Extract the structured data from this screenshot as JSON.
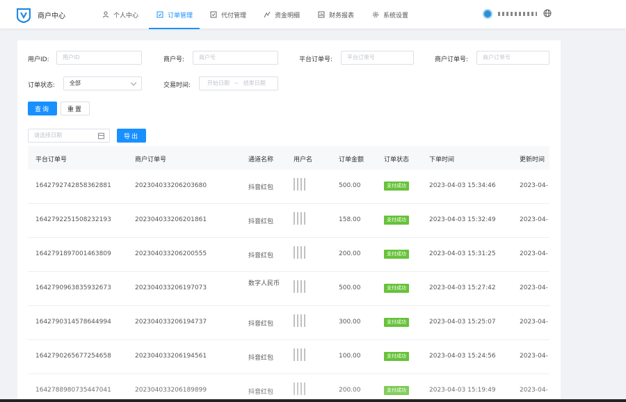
{
  "app": {
    "brand": "商户中心",
    "username": ""
  },
  "nav": [
    {
      "label": "个人中心",
      "icon": "user-icon"
    },
    {
      "label": "订单管理",
      "icon": "order-icon",
      "active": true
    },
    {
      "label": "代付管理",
      "icon": "payout-icon"
    },
    {
      "label": "资金明细",
      "icon": "funds-icon"
    },
    {
      "label": "财务报表",
      "icon": "report-icon"
    },
    {
      "label": "系统设置",
      "icon": "gear-icon"
    }
  ],
  "filters": {
    "user_id": {
      "label": "用户ID:",
      "placeholder": "用户ID"
    },
    "merchant_no": {
      "label": "商户号:",
      "placeholder": "商户号"
    },
    "platform_order": {
      "label": "平台订单号:",
      "placeholder": "平台订单号"
    },
    "merchant_order": {
      "label": "商户订单号:",
      "placeholder": "商户订单号"
    },
    "order_status": {
      "label": "订单状态:",
      "value": "全部"
    },
    "trade_time": {
      "label": "交易时间:",
      "start": "开始日期",
      "sep": "~",
      "end": "结束日期"
    }
  },
  "buttons": {
    "search": "查询",
    "reset": "重置",
    "export": "导出"
  },
  "export_date": {
    "placeholder": "请选择日期"
  },
  "table": {
    "headers": [
      "平台订单号",
      "商户订单号",
      "通道名称",
      "用户名",
      "订单金额",
      "订单状态",
      "下单时间",
      "更新时间"
    ],
    "rows": [
      {
        "platform": "1642792742858362881",
        "merchant": "202304033206203680",
        "channel": "抖音红包",
        "amount": "500.00",
        "status": "支付成功",
        "created": "2023-04-03 15:34:46",
        "updated": "2023-04-"
      },
      {
        "platform": "1642792251508232193",
        "merchant": "202304033206201861",
        "channel": "抖音红包",
        "amount": "158.00",
        "status": "支付成功",
        "created": "2023-04-03 15:32:49",
        "updated": "2023-04-"
      },
      {
        "platform": "1642791897001463809",
        "merchant": "202304033206200555",
        "channel": "抖音红包",
        "amount": "200.00",
        "status": "支付成功",
        "created": "2023-04-03 15:31:25",
        "updated": "2023-04-"
      },
      {
        "platform": "1642790963835932673",
        "merchant": "202304033206197073",
        "channel": "数字人民币",
        "amount": "500.00",
        "status": "支付成功",
        "created": "2023-04-03 15:27:42",
        "updated": "2023-04-"
      },
      {
        "platform": "1642790314578644994",
        "merchant": "202304033206194737",
        "channel": "抖音红包",
        "amount": "300.00",
        "status": "支付成功",
        "created": "2023-04-03 15:25:07",
        "updated": "2023-04-"
      },
      {
        "platform": "1642790265677254658",
        "merchant": "202304033206194561",
        "channel": "抖音红包",
        "amount": "100.00",
        "status": "支付成功",
        "created": "2023-04-03 15:24:56",
        "updated": "2023-04-"
      },
      {
        "platform": "1642788980735447041",
        "merchant": "202304033206189899",
        "channel": "抖音红包",
        "amount": "200.00",
        "status": "支付成功",
        "created": "2023-04-03 15:19:49",
        "updated": "2023-04-"
      }
    ]
  },
  "colors": {
    "accent": "#1890ff",
    "success": "#67c23a"
  }
}
